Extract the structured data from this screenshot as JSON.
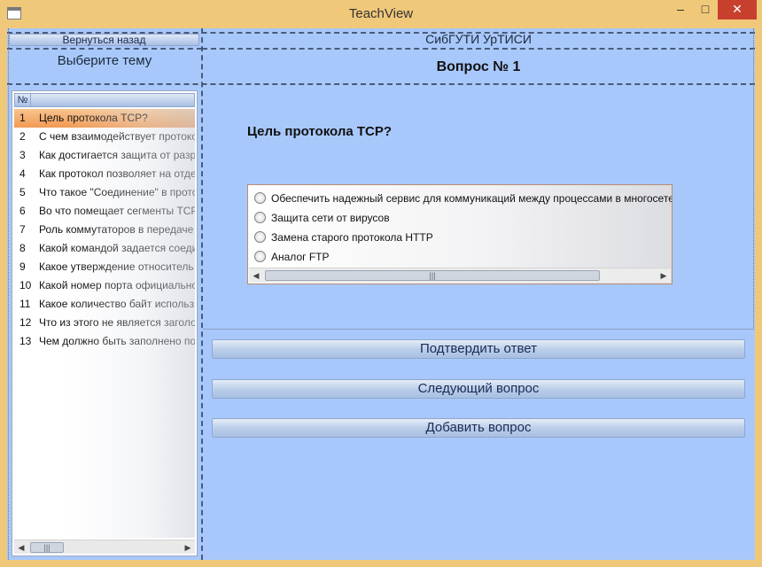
{
  "window": {
    "title": "TeachView",
    "minimize_glyph": "–",
    "maximize_glyph": "□",
    "close_glyph": "✕"
  },
  "left": {
    "back_label": "Вернуться назад",
    "topic_label": "Выберите тему",
    "list_header_num": "№",
    "items": [
      {
        "num": "1",
        "text": "Цель протокола TCP?"
      },
      {
        "num": "2",
        "text": "С чем взаимодействует протоко"
      },
      {
        "num": "3",
        "text": "Как достигается  защита от разр"
      },
      {
        "num": "4",
        "text": "Как протокол позволяет на отде"
      },
      {
        "num": "5",
        "text": "Что такое \"Соединение\" в прото"
      },
      {
        "num": "6",
        "text": "Во что помещает сегменты TCP"
      },
      {
        "num": "7",
        "text": "Роль коммутаторов в передаче"
      },
      {
        "num": "8",
        "text": "Какой командой задается соеди"
      },
      {
        "num": "9",
        "text": "Какое утверждение относитель"
      },
      {
        "num": "10",
        "text": "Какой номер порта официально"
      },
      {
        "num": "11",
        "text": "Какое количество байт использ"
      },
      {
        "num": "12",
        "text": "Что из этого не является заголо"
      },
      {
        "num": "13",
        "text": "Чем должно быть заполнено по."
      }
    ],
    "selected_index": 0
  },
  "right": {
    "institute": "СибГУТИ УрТИСИ",
    "question_header": "Вопрос № 1",
    "question_text": "Цель протокола TCP?",
    "answers": [
      "Обеспечить надежный сервис для коммуникаций между процессами в многосетевой системе",
      "Защита сети от вирусов",
      "Замена старого протокола HTTP",
      "Аналог FTP"
    ],
    "confirm_label": "Подтвердить ответ",
    "next_label": "Следующий вопрос",
    "add_label": "Добавить вопрос"
  },
  "colors": {
    "accent": "#a8c8fb",
    "frame": "#f0c87a",
    "selection": "#f29952"
  },
  "icons": {
    "scroll_left": "◀",
    "scroll_right": "▶",
    "thumb_grip": "|||"
  }
}
